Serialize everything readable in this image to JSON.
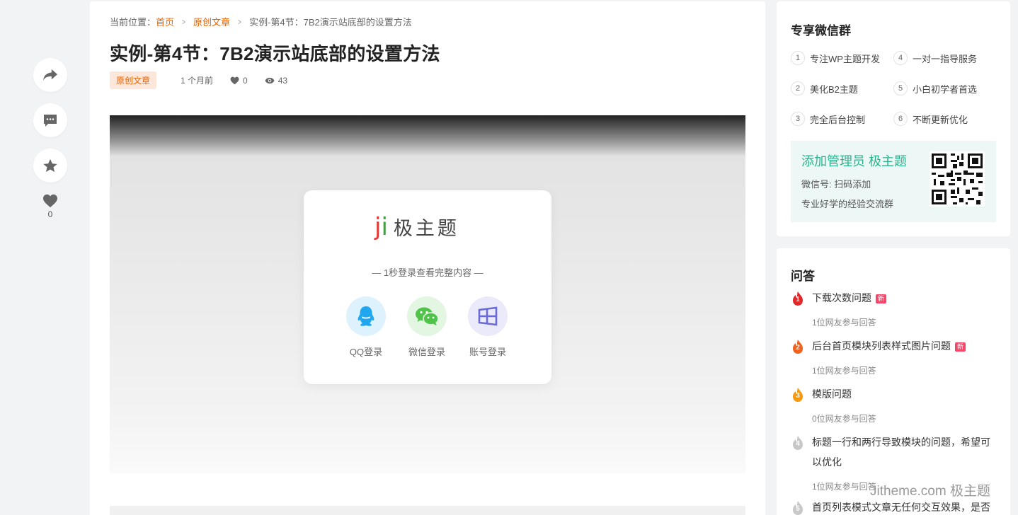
{
  "breadcrumb": {
    "prefix": "当前位置：",
    "home": "首页",
    "category": "原创文章",
    "current": "实例-第4节：7B2演示站底部的设置方法"
  },
  "article": {
    "title": "实例-第4节：7B2演示站底部的设置方法",
    "tag": "原创文章",
    "time": "1 个月前",
    "likes": "0",
    "views": "43"
  },
  "rail": {
    "like_count": "0",
    "icons": [
      "share-icon",
      "comment-icon",
      "star-icon",
      "heart-icon"
    ]
  },
  "login_box": {
    "logo_j": "j",
    "logo_i": "i",
    "logo_text": "极主题",
    "hint": "— 1秒登录查看完整内容 —",
    "options": [
      {
        "label": "QQ登录",
        "icon": "qq-icon",
        "color": "#20a7f0",
        "bg": "#ddf2fd"
      },
      {
        "label": "微信登录",
        "icon": "wechat-icon",
        "color": "#4fc34a",
        "bg": "#e3f6e2"
      },
      {
        "label": "账号登录",
        "icon": "windows-icon",
        "color": "#6b6bd8",
        "bg": "#ebeafb"
      }
    ]
  },
  "wechat_group": {
    "title": "专享微信群",
    "features": [
      {
        "num": "1",
        "text": "专注WP主题开发"
      },
      {
        "num": "4",
        "text": "一对一指导服务"
      },
      {
        "num": "2",
        "text": "美化B2主题"
      },
      {
        "num": "5",
        "text": "小白初学者首选"
      },
      {
        "num": "3",
        "text": "完全后台控制"
      },
      {
        "num": "6",
        "text": "不断更新优化"
      }
    ],
    "promo_title": "添加管理员 极主题",
    "promo_line1": "微信号: 扫码添加",
    "promo_line2": "专业好学的经验交流群"
  },
  "qa": {
    "title": "问答",
    "new_label": "新",
    "items": [
      {
        "rank": "1",
        "question": "下载次数问题",
        "is_new": true,
        "answers": "1位网友参与回答",
        "color": "#e02a2a"
      },
      {
        "rank": "2",
        "question": "后台首页模块列表样式图片问题",
        "is_new": true,
        "answers": "1位网友参与回答",
        "color": "#f2621f"
      },
      {
        "rank": "3",
        "question": "模版问题",
        "is_new": false,
        "answers": "0位网友参与回答",
        "color": "#f59a12"
      },
      {
        "rank": "4",
        "question": "标题一行和两行导致模块的问题，希望可以优化",
        "is_new": false,
        "answers": "1位网友参与回答",
        "color": "#c8c8c8"
      },
      {
        "rank": "5",
        "question": "首页列表模式文章无任何交互效果，是否",
        "is_new": false,
        "answers": "",
        "color": "#c8c8c8"
      }
    ]
  },
  "watermark": "Jitheme.com 极主题"
}
